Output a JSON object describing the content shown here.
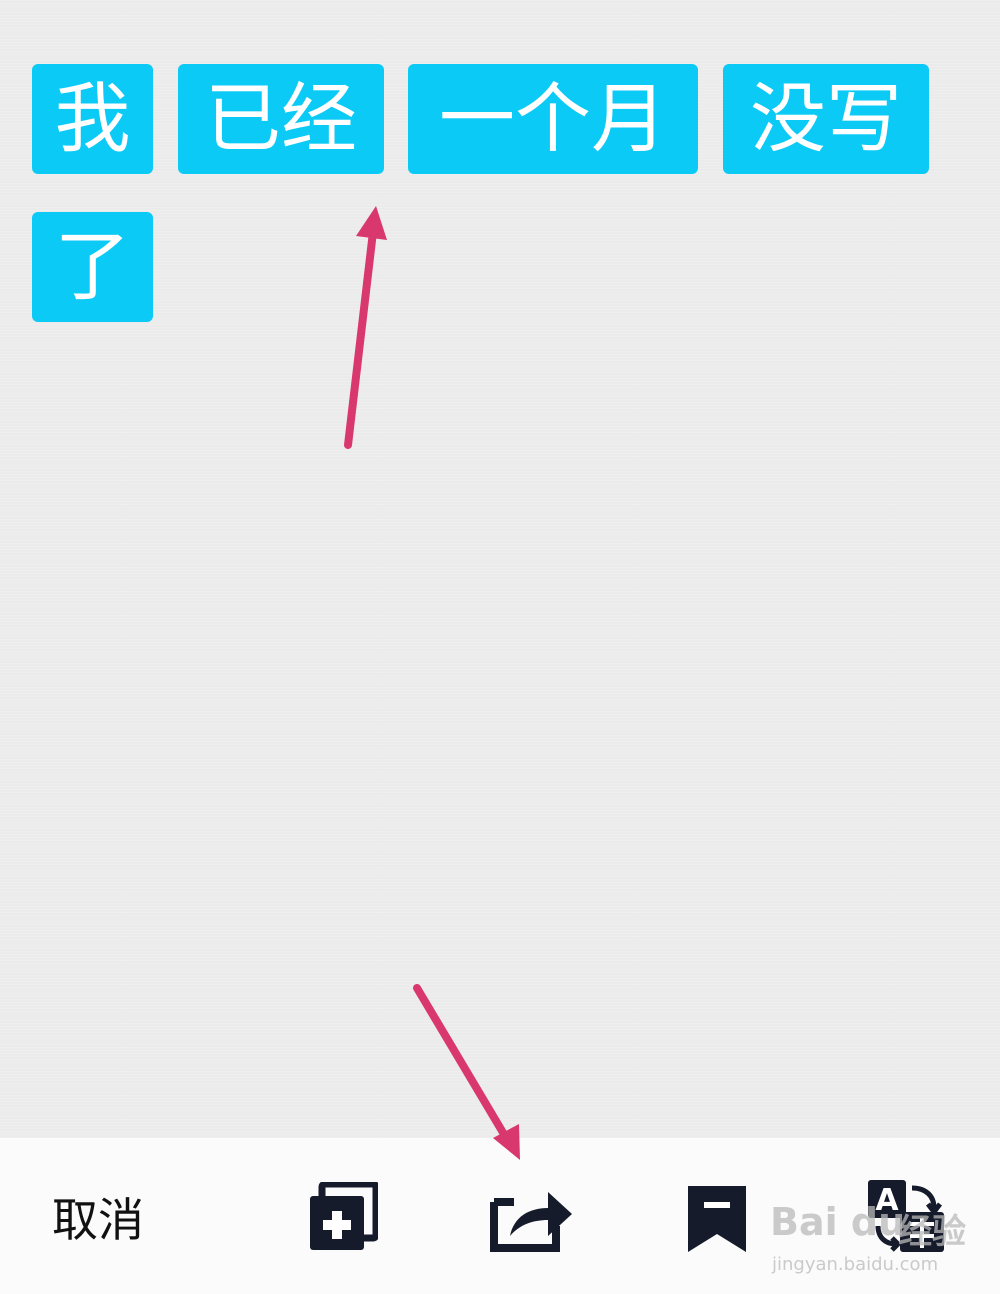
{
  "chips": [
    {
      "text": "我"
    },
    {
      "text": "已经"
    },
    {
      "text": "一个月"
    },
    {
      "text": "没写"
    },
    {
      "text": "了"
    }
  ],
  "toolbar": {
    "cancel_label": "取消",
    "icons": [
      "copy-add-icon",
      "share-icon",
      "bookmark-icon",
      "translate-icon"
    ]
  },
  "annotation_color": "#d9386f",
  "chip_color": "#0ccaf6",
  "watermark": {
    "brand": "Bai du",
    "cn": "经验",
    "url": "jingyan.baidu.com"
  }
}
